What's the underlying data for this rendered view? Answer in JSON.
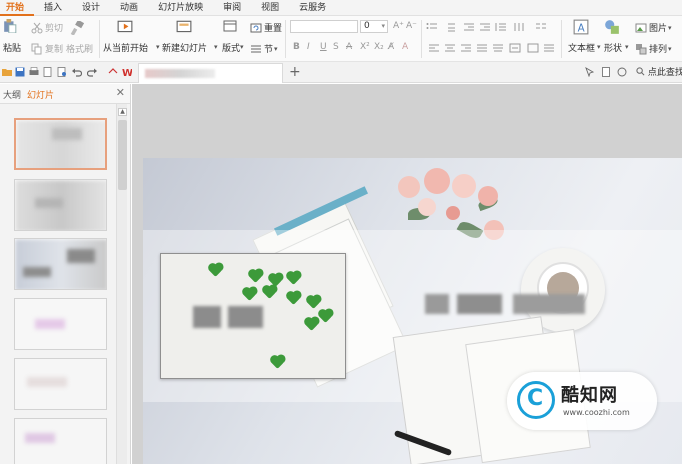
{
  "menu": {
    "tabs": [
      "开始",
      "插入",
      "设计",
      "动画",
      "幻灯片放映",
      "审阅",
      "视图",
      "云服务"
    ],
    "active_index": 0
  },
  "ribbon": {
    "paste": "粘贴",
    "cut": "剪切",
    "copy": "复制",
    "format_painter": "格式刷",
    "from_current": "从当前开始",
    "new_slide": "新建幻灯片",
    "layout": "版式",
    "reset": "重置",
    "section": "节",
    "font_size": "0",
    "text_box": "文本框",
    "shape": "形状",
    "picture": "图片",
    "arrange": "排列"
  },
  "quickbar": {
    "find_label": "点此查找"
  },
  "left_panel": {
    "tab_outline": "大纲",
    "tab_slides": "幻灯片",
    "close_symbol": "✕",
    "scroll_up_symbol": "▲"
  },
  "watermark": {
    "brand": "酷知网",
    "url": "www.coozhi.com",
    "logo_letter": "C"
  },
  "icons": {
    "accent": "#e2711c",
    "heart_green": "#3c9a3a",
    "logo_blue": "#1aa0d8"
  }
}
